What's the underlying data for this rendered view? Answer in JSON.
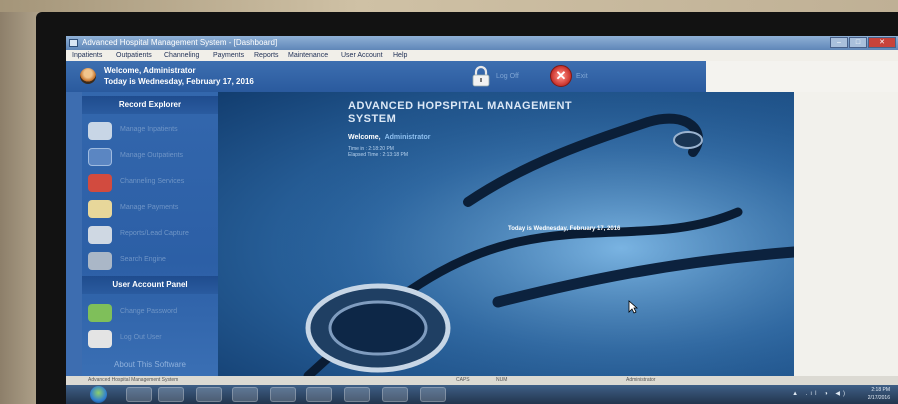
{
  "window": {
    "title": "Advanced Hospital Management System - [Dashboard]",
    "controls": [
      "–",
      "□",
      "✕"
    ]
  },
  "menu": {
    "items": [
      "Inpatients",
      "Outpatients",
      "Channeling",
      "Payments",
      "Reports",
      "Maintenance",
      "User Account",
      "Help"
    ]
  },
  "header": {
    "welcome": "Welcome, Administrator",
    "today": "Today is Wednesday, February 17, 2016",
    "lock_label": "Log Off",
    "exit_label": "Exit",
    "exit_glyph": "✕"
  },
  "sidebar": {
    "record_explorer_title": "Record Explorer",
    "record_items": [
      {
        "label": "Manage Inpatients",
        "icon": "inpatient-icon",
        "color": "#c8d6e6"
      },
      {
        "label": "Manage Outpatients",
        "icon": "wheelchair-icon",
        "color": "#5b86c2"
      },
      {
        "label": "Channeling Services",
        "icon": "telephone-icon",
        "color": "#d24b3f"
      },
      {
        "label": "Manage Payments",
        "icon": "money-icon",
        "color": "#e8d79a"
      },
      {
        "label": "Reports/Lead Capture",
        "icon": "folder-icon",
        "color": "#cfd8e3"
      },
      {
        "label": "Search Engine",
        "icon": "binoculars-icon",
        "color": "#aab7c7"
      }
    ],
    "user_panel_title": "User Account Panel",
    "user_items": [
      {
        "label": "Change Password",
        "icon": "users-icon",
        "color": "#7fbf5a"
      },
      {
        "label": "Log Out User",
        "icon": "lock-icon",
        "color": "#e4e4e4"
      }
    ],
    "about_title": "About This Software"
  },
  "main": {
    "system_title": "ADVANCED HOPSPITAL MANAGEMENT SYSTEM",
    "welcome_label": "Welcome,",
    "welcome_user": "Administrator",
    "login_time": "Time in : 2:18:20 PM",
    "elapsed_time": "Elapsed Time : 2:13:18 PM",
    "today": "Today is Wednesday, February 17, 2016"
  },
  "statusbar": {
    "app_name": "Advanced Hospital Management System",
    "caps": "CAPS",
    "num": "NUM",
    "user": "Administrator"
  },
  "taskbar": {
    "time": "2:18 PM",
    "date": "2/17/2016",
    "tray": "▲ .ıl ◑ ◀)"
  },
  "colors": {
    "header_blue": "#2f62a8",
    "sidebar_blue": "#2c5fa6",
    "section_header": "#1f4c8e",
    "main_bg": "#2e6aa6"
  }
}
